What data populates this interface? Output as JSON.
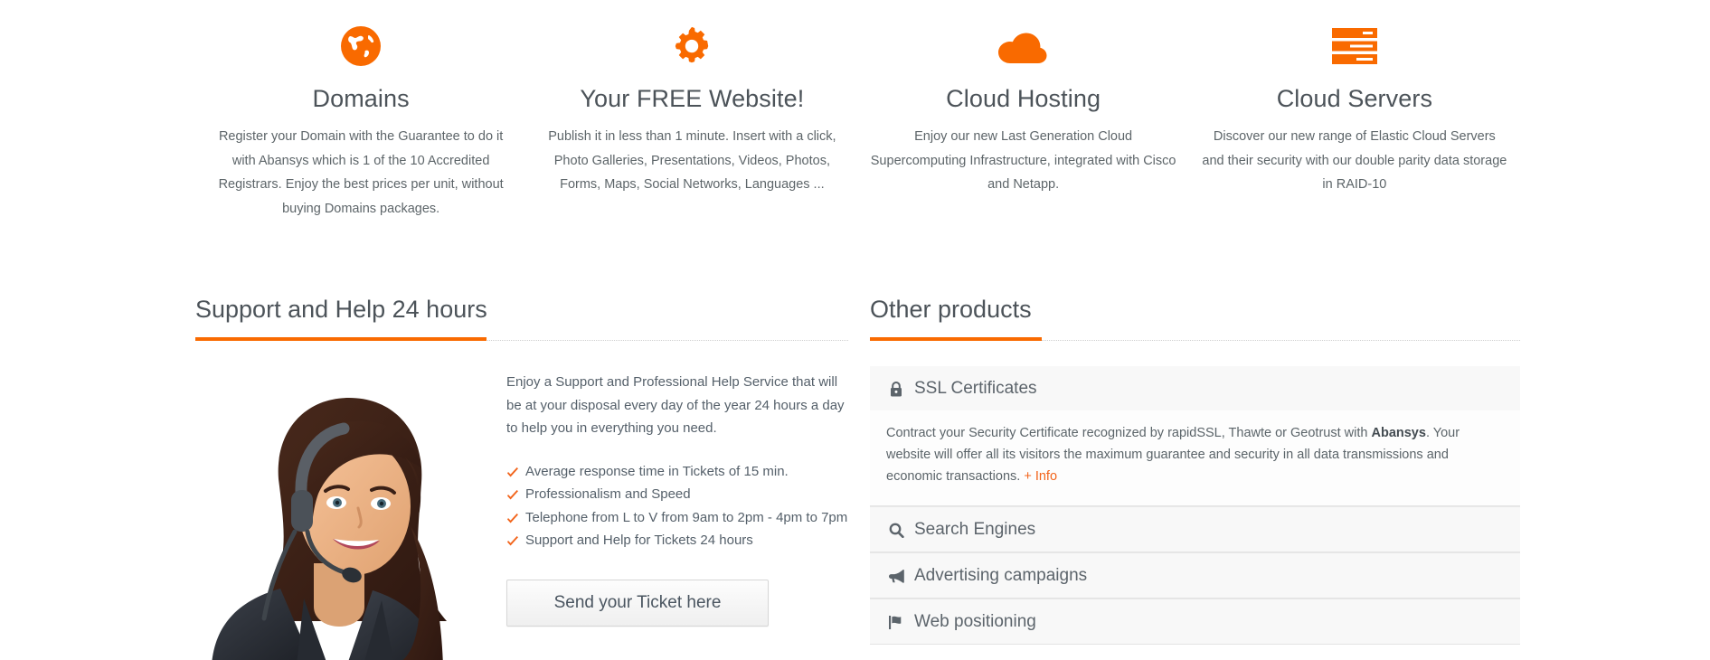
{
  "brand": {
    "accent": "#f96a00",
    "accent_link": "#f2641b",
    "heading_color": "#4c5359",
    "body_color": "#55606a"
  },
  "features": [
    {
      "icon": "globe-icon",
      "title": "Domains",
      "desc": "Register your Domain with the Guarantee to do it with Abansys which is 1 of the 10 Accredited Registrars. Enjoy the best prices per unit, without buying Domains packages."
    },
    {
      "icon": "gear-icon",
      "title": "Your FREE Website!",
      "desc": "Publish it in less than 1 minute. Insert with a click, Photo Galleries, Presentations, Videos, Photos, Forms, Maps, Social Networks, Languages ..."
    },
    {
      "icon": "cloud-icon",
      "title": "Cloud Hosting",
      "desc": "Enjoy our new Last Generation Cloud Supercomputing Infrastructure, integrated with Cisco and Netapp."
    },
    {
      "icon": "server-icon",
      "title": "Cloud Servers",
      "desc": "Discover our new range of Elastic Cloud Servers and their security with our double parity data storage in RAID-10"
    }
  ],
  "support": {
    "heading": "Support and Help 24 hours",
    "photo_alt": "support-agent-with-headset",
    "paragraph": "Enjoy a Support and Professional Help Service that will be at your disposal every day of the year 24 hours a day to help you in everything you need.",
    "bullet_icon": "check-icon",
    "bullets": [
      "Average response time in Tickets of 15 min.",
      "Professionalism and Speed",
      "Telephone from L to V from 9am to 2pm - 4pm to 7pm",
      "Support and Help for Tickets 24 hours"
    ],
    "button_label": "Send your Ticket here"
  },
  "other_products": {
    "heading": "Other products",
    "items": [
      {
        "icon": "lock-icon",
        "label": "SSL Certificates",
        "expanded": true,
        "body_pre": "Contract your Security Certificate recognized by rapidSSL, Thawte or Geotrust with ",
        "body_bold": "Abansys",
        "body_post": ". Your website will offer all its visitors the maximum guarantee and security in all data transmissions and economic transactions. ",
        "link": "+ Info"
      },
      {
        "icon": "search-icon",
        "label": "Search Engines",
        "expanded": false
      },
      {
        "icon": "megaphone-icon",
        "label": "Advertising campaigns",
        "expanded": false
      },
      {
        "icon": "flag-icon",
        "label": "Web positioning",
        "expanded": false
      }
    ]
  }
}
